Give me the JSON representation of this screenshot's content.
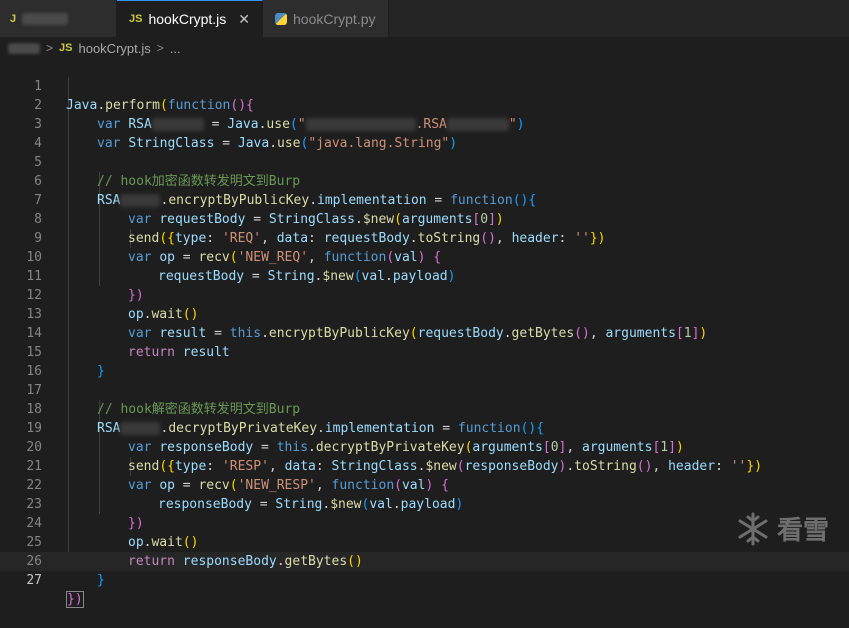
{
  "tabs": {
    "first_badge": "J",
    "active_badge": "JS",
    "active_label": "hookCrypt.js",
    "close_glyph": "✕",
    "second_label": "hookCrypt.py"
  },
  "breadcrumb": {
    "badge": "JS",
    "file": "hookCrypt.js",
    "sep1": ">",
    "sep2": ">",
    "more": "..."
  },
  "editor": {
    "line_numbers": [
      "1",
      "2",
      "3",
      "4",
      "5",
      "6",
      "7",
      "8",
      "9",
      "10",
      "11",
      "12",
      "13",
      "14",
      "15",
      "16",
      "17",
      "18",
      "19",
      "20",
      "21",
      "22",
      "23",
      "24",
      "25",
      "26",
      "27"
    ],
    "tokens": {
      "l1": [
        "Java",
        ".",
        "perform",
        "(",
        "function",
        "(){"
      ],
      "l2": [
        "var",
        "RSA",
        " = ",
        "Java",
        ".",
        "use",
        "(",
        "\"",
        ".RSA",
        "\"",
        ")"
      ],
      "l3": [
        "var",
        "StringClass",
        " = ",
        "Java",
        ".",
        "use",
        "(",
        "\"java.lang.String\"",
        ")"
      ],
      "l5": [
        "// hook加密函数转发明文到Burp"
      ],
      "l6": [
        "RSA",
        ".",
        "encryptByPublicKey",
        ".",
        "implementation",
        " = ",
        "function",
        "(){"
      ],
      "l7": [
        "var",
        "requestBody",
        " = ",
        "StringClass",
        ".",
        "$new",
        "(",
        "arguments",
        "[",
        "0",
        "]",
        ")"
      ],
      "l8": [
        "send",
        "({",
        "type",
        ": ",
        "'REQ'",
        ", ",
        "data",
        ": ",
        "requestBody",
        ".",
        "toString",
        "()",
        ", ",
        "header",
        ": ",
        "''",
        "})"
      ],
      "l9": [
        "var",
        "op",
        " = ",
        "recv",
        "(",
        "'NEW_REQ'",
        ", ",
        "function",
        "(",
        "val",
        ") {"
      ],
      "l10": [
        "requestBody",
        " = ",
        "String",
        ".",
        "$new",
        "(",
        "val",
        ".",
        "payload",
        ")"
      ],
      "l11": [
        "})"
      ],
      "l12": [
        "op",
        ".",
        "wait",
        "()"
      ],
      "l13": [
        "var",
        "result",
        " = ",
        "this",
        ".",
        "encryptByPublicKey",
        "(",
        "requestBody",
        ".",
        "getBytes",
        "()",
        ", ",
        "arguments",
        "[",
        "1",
        "]",
        ")"
      ],
      "l14": [
        "return",
        "result"
      ],
      "l15": [
        "}"
      ],
      "l17": [
        "// hook解密函数转发明文到Burp"
      ],
      "l18": [
        "RSA",
        ".",
        "decryptByPrivateKey",
        ".",
        "implementation",
        " = ",
        "function",
        "(){"
      ],
      "l19": [
        "var",
        "responseBody",
        " = ",
        "this",
        ".",
        "decryptByPrivateKey",
        "(",
        "arguments",
        "[",
        "0",
        "]",
        ", ",
        "arguments",
        "[",
        "1",
        "]",
        ")"
      ],
      "l20": [
        "send",
        "({",
        "type",
        ": ",
        "'RESP'",
        ", ",
        "data",
        ": ",
        "StringClass",
        ".",
        "$new",
        "(",
        "responseBody",
        ")",
        ".",
        "toString",
        "()",
        ", ",
        "header",
        ": ",
        "''",
        "})"
      ],
      "l21": [
        "var",
        "op",
        " = ",
        "recv",
        "(",
        "'NEW_RESP'",
        ", ",
        "function",
        "(",
        "val",
        ") {"
      ],
      "l22": [
        "responseBody",
        " = ",
        "String",
        ".",
        "$new",
        "(",
        "val",
        ".",
        "payload",
        ")"
      ],
      "l23": [
        "})"
      ],
      "l24": [
        "op",
        ".",
        "wait",
        "()"
      ],
      "l25": [
        "return",
        "responseBody",
        ".",
        "getBytes",
        "()"
      ],
      "l26": [
        "}"
      ],
      "l27": [
        "})"
      ]
    }
  },
  "watermark": {
    "text": "看雪",
    "icon": "snowflake-icon"
  },
  "colors": {
    "background": "#1e1e1e",
    "keyword": "#569cd6",
    "string": "#ce9178",
    "comment": "#6a9955",
    "function": "#dcdcaa",
    "variable": "#9cdcfe"
  }
}
